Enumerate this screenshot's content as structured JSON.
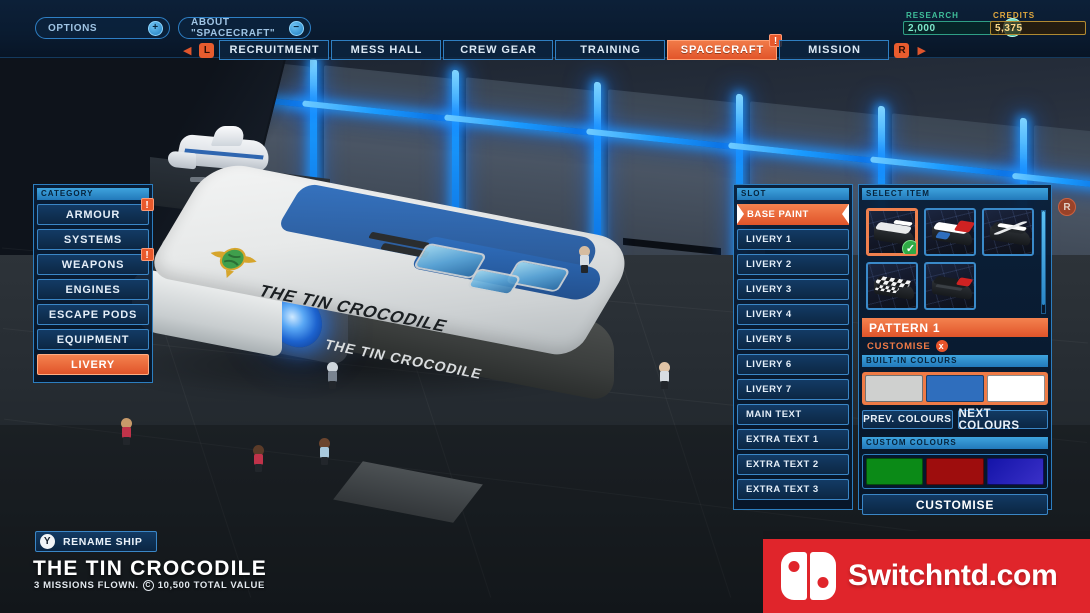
{
  "topbar": {
    "options_label": "OPTIONS",
    "options_knob": "+",
    "about_label": "ABOUT \"SPACECRAFT\"",
    "about_knob": "−",
    "research_caption": "RESEARCH",
    "research_value": "2,000",
    "research_icon": "research-orb-icon",
    "credits_caption": "CREDITS",
    "credits_value": "5,375",
    "credits_icon": "credit-coin-icon",
    "left_arrow": "◀",
    "right_arrow": "▶",
    "left_bumper": "L",
    "right_bumper": "R",
    "tabs": [
      {
        "label": "RECRUITMENT",
        "active": false,
        "badge": ""
      },
      {
        "label": "MESS HALL",
        "active": false,
        "badge": ""
      },
      {
        "label": "CREW GEAR",
        "active": false,
        "badge": ""
      },
      {
        "label": "TRAINING",
        "active": false,
        "badge": ""
      },
      {
        "label": "SPACECRAFT",
        "active": true,
        "badge": "!"
      },
      {
        "label": "MISSION",
        "active": false,
        "badge": ""
      }
    ]
  },
  "category_panel": {
    "header": "CATEGORY",
    "items": [
      {
        "label": "ARMOUR",
        "active": false,
        "badge": "!"
      },
      {
        "label": "SYSTEMS",
        "active": false,
        "badge": ""
      },
      {
        "label": "WEAPONS",
        "active": false,
        "badge": "!"
      },
      {
        "label": "ENGINES",
        "active": false,
        "badge": ""
      },
      {
        "label": "ESCAPE PODS",
        "active": false,
        "badge": ""
      },
      {
        "label": "EQUIPMENT",
        "active": false,
        "badge": ""
      },
      {
        "label": "LIVERY",
        "active": true,
        "badge": ""
      }
    ]
  },
  "slot_panel": {
    "header": "SLOT",
    "items": [
      {
        "label": "BASE PAINT",
        "active": true
      },
      {
        "label": "LIVERY 1",
        "active": false
      },
      {
        "label": "LIVERY 2",
        "active": false
      },
      {
        "label": "LIVERY 3",
        "active": false
      },
      {
        "label": "LIVERY 4",
        "active": false
      },
      {
        "label": "LIVERY 5",
        "active": false
      },
      {
        "label": "LIVERY 6",
        "active": false
      },
      {
        "label": "LIVERY 7",
        "active": false
      },
      {
        "label": "MAIN TEXT",
        "active": false
      },
      {
        "label": "EXTRA TEXT 1",
        "active": false
      },
      {
        "label": "EXTRA TEXT 2",
        "active": false
      },
      {
        "label": "EXTRA TEXT 3",
        "active": false
      }
    ]
  },
  "select_item_panel": {
    "header": "SELECT ITEM",
    "thumbnails": [
      {
        "name": "pattern-1",
        "selected": true,
        "checked": true,
        "deck": "#e8eaec",
        "accent": "#ffffff",
        "accent2": ""
      },
      {
        "name": "pattern-2",
        "selected": false,
        "checked": false,
        "deck": "#ffffff",
        "accent": "#cf2222",
        "accent2": "#2f6ebd"
      },
      {
        "name": "pattern-3",
        "selected": false,
        "checked": false,
        "deck": "#22262a",
        "accent": "#ffffff",
        "accent2": "#e8eaec"
      },
      {
        "name": "pattern-4",
        "selected": false,
        "checked": false,
        "deck": "#f2f3f4",
        "accent": "#17191c",
        "accent2": "#ffffff"
      },
      {
        "name": "pattern-5",
        "selected": false,
        "checked": false,
        "deck": "#1a1d20",
        "accent": "#cf2222",
        "accent2": "#3a3f44"
      }
    ],
    "pattern_label": "PATTERN 1",
    "customise_toggle_label": "CUSTOMISE",
    "customise_toggle_icon": "x",
    "builtin_header": "BUILT-IN COLOURS",
    "builtin_colours": [
      "#cfd0cf",
      "#2f6ebd",
      "#ffffff"
    ],
    "prev_colours_label": "PREV. COLOURS",
    "next_colours_label": "NEXT COLOURS",
    "custom_header": "CUSTOM COLOURS",
    "custom_colours": [
      "#0b8a17",
      "#9e0d0d",
      "#1414a8"
    ],
    "customise_button_label": "CUSTOMISE"
  },
  "ship_info": {
    "rename_label": "RENAME SHIP",
    "rename_button_glyph": "Y",
    "name": "THE TIN CROCODILE",
    "missions_text": "3 MISSIONS FLOWN.",
    "value_text": "10,500 TOTAL VALUE",
    "value_icon": "C"
  },
  "ship_render": {
    "hull_text_upper": "THE TIN CROCODILE",
    "hull_text_lower": "THE TIN CROCODILE",
    "emblem": "winged-globe-emblem"
  },
  "corner_hint": {
    "label": "R"
  },
  "watermark": {
    "text": "Switchntd.com",
    "logo": "nintendo-switch-logo"
  },
  "theme": {
    "accent_orange": "#e8592c",
    "panel_blue": "#2c7ec0",
    "header_blue": "#3ea3dd",
    "neon_blue": "#1a9bff",
    "green_check": "#2faa46"
  }
}
